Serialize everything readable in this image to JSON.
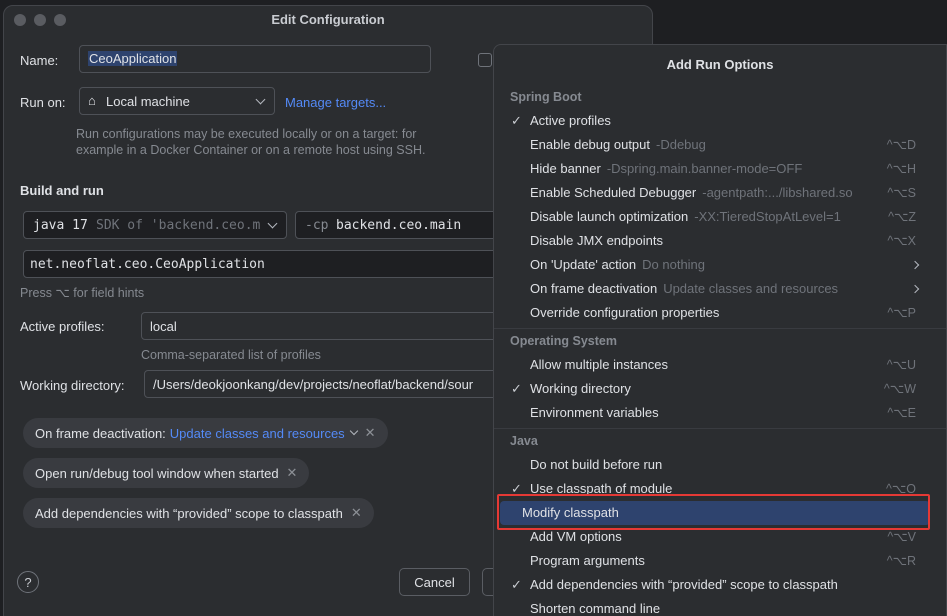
{
  "dialog": {
    "title": "Edit Configuration",
    "name_label": "Name:",
    "name_value": "CeoApplication",
    "run_on_label": "Run on:",
    "run_on_value": "Local machine",
    "manage_targets": "Manage targets...",
    "run_on_hint": "Run configurations may be executed locally or on a target: for example in a Docker Container or on a remote host using SSH.",
    "build_and_run": "Build and run",
    "jdk_value": "java 17",
    "jdk_hint": "SDK of 'backend.ceo.m",
    "cp_flag": "-cp",
    "cp_value": "backend.ceo.main",
    "main_class": "net.neoflat.ceo.CeoApplication",
    "field_hints": "Press ⌥ for field hints",
    "active_profiles_label": "Active profiles:",
    "active_profiles_value": "local",
    "active_profiles_hint": "Comma-separated list of profiles",
    "working_dir_label": "Working directory:",
    "working_dir_value": "/Users/deokjoonkang/dev/projects/neoflat/backend/sour",
    "chip1_label": "On frame deactivation:",
    "chip1_value": "Update classes and resources",
    "chip2_label": "Open run/debug tool window when started",
    "chip3_label": "Add dependencies with “provided” scope to classpath",
    "cancel": "Cancel",
    "help": "?"
  },
  "popup": {
    "title": "Add Run Options",
    "sections": [
      {
        "name": "Spring Boot",
        "items": [
          {
            "label": "Active profiles",
            "checked": true,
            "hint": "",
            "shortcut": ""
          },
          {
            "label": "Enable debug output",
            "checked": false,
            "hint": "-Ddebug",
            "shortcut": "^⌥D"
          },
          {
            "label": "Hide banner",
            "checked": false,
            "hint": "-Dspring.main.banner-mode=OFF",
            "shortcut": "^⌥H"
          },
          {
            "label": "Enable Scheduled Debugger",
            "checked": false,
            "hint": "-agentpath:.../libshared.so",
            "shortcut": "^⌥S"
          },
          {
            "label": "Disable launch optimization",
            "checked": false,
            "hint": "-XX:TieredStopAtLevel=1",
            "shortcut": "^⌥Z"
          },
          {
            "label": "Disable JMX endpoints",
            "checked": false,
            "hint": "",
            "shortcut": "^⌥X"
          },
          {
            "label": "On 'Update' action",
            "checked": false,
            "hint": "Do nothing",
            "shortcut": "",
            "submenu": true
          },
          {
            "label": "On frame deactivation",
            "checked": false,
            "hint": "Update classes and resources",
            "shortcut": "",
            "submenu": true
          },
          {
            "label": "Override configuration properties",
            "checked": false,
            "hint": "",
            "shortcut": "^⌥P"
          }
        ]
      },
      {
        "name": "Operating System",
        "items": [
          {
            "label": "Allow multiple instances",
            "checked": false,
            "hint": "",
            "shortcut": "^⌥U"
          },
          {
            "label": "Working directory",
            "checked": true,
            "hint": "",
            "shortcut": "^⌥W"
          },
          {
            "label": "Environment variables",
            "checked": false,
            "hint": "",
            "shortcut": "^⌥E"
          }
        ]
      },
      {
        "name": "Java",
        "items": [
          {
            "label": "Do not build before run",
            "checked": false,
            "hint": "",
            "shortcut": ""
          },
          {
            "label": "Use classpath of module",
            "checked": true,
            "hint": "",
            "shortcut": "^⌥O"
          },
          {
            "label": "Modify classpath",
            "checked": false,
            "hint": "",
            "shortcut": "",
            "selected": true
          },
          {
            "label": "Add VM options",
            "checked": false,
            "hint": "",
            "shortcut": "^⌥V"
          },
          {
            "label": "Program arguments",
            "checked": false,
            "hint": "",
            "shortcut": "^⌥R"
          },
          {
            "label": "Add dependencies with “provided” scope to classpath",
            "checked": true,
            "hint": "",
            "shortcut": ""
          },
          {
            "label": "Shorten command line",
            "checked": false,
            "hint": "",
            "shortcut": ""
          }
        ]
      }
    ]
  },
  "colors": {
    "accent": "#548af7",
    "selection": "#2e436e",
    "highlight": "#e53935"
  }
}
